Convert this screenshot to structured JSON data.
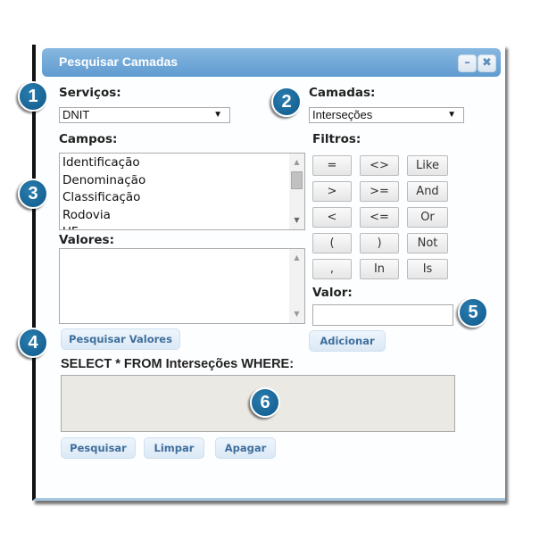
{
  "window": {
    "title": "Pesquisar Camadas",
    "minimize_glyph": "–",
    "close_glyph": "✖"
  },
  "servicos": {
    "label": "Serviços:",
    "selected": "DNIT"
  },
  "camadas": {
    "label": "Camadas:",
    "selected": "Interseções"
  },
  "campos": {
    "label": "Campos:",
    "items": [
      "Identificação",
      "Denominação",
      "Classificação",
      "Rodovia",
      "UF"
    ]
  },
  "filtros": {
    "label": "Filtros:",
    "buttons": [
      [
        "=",
        "<>",
        "Like"
      ],
      [
        ">",
        ">=",
        "And"
      ],
      [
        "<",
        "<=",
        "Or"
      ],
      [
        "(",
        ")",
        "Not"
      ],
      [
        ",",
        "In",
        "Is"
      ]
    ]
  },
  "valores": {
    "label": "Valores:",
    "search_button": "Pesquisar Valores"
  },
  "valor": {
    "label": "Valor:",
    "value": "",
    "add_button": "Adicionar"
  },
  "query": {
    "label": "SELECT * FROM Interseções WHERE:",
    "value": ""
  },
  "actions": {
    "search": "Pesquisar",
    "clear": "Limpar",
    "delete": "Apagar"
  },
  "callouts": [
    "1",
    "2",
    "3",
    "4",
    "5",
    "6"
  ],
  "colors": {
    "titlebar": "#6fa7d8",
    "callout": "#1a6a9c",
    "button_text": "#3f6e9c"
  }
}
